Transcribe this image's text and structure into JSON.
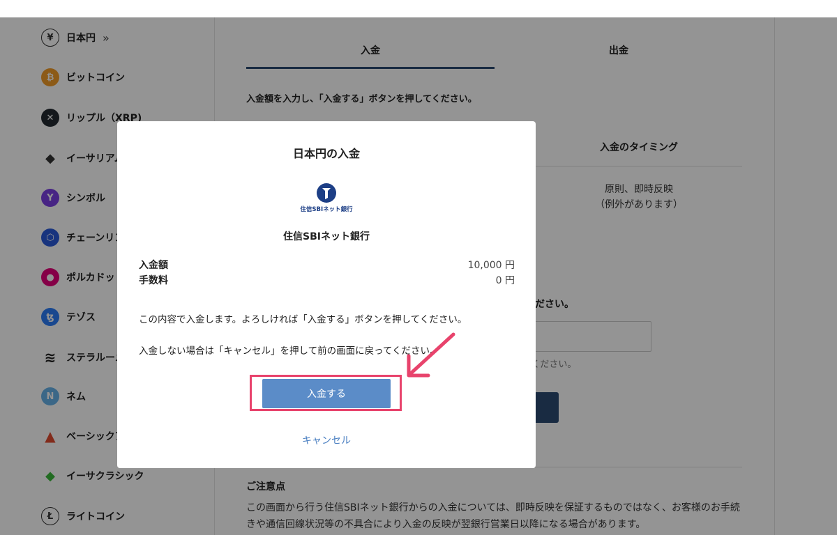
{
  "sidebar": {
    "items": [
      {
        "label": "日本円",
        "glyph": "¥",
        "color": "#ffffff",
        "extra": "»"
      },
      {
        "label": "ビットコイン",
        "glyph": "₿",
        "color": "#f29b29"
      },
      {
        "label": "リップル（XRP)",
        "glyph": "✕",
        "color": "#232a31"
      },
      {
        "label": "イーサリアム",
        "glyph": "◆",
        "color": "#ffffff"
      },
      {
        "label": "シンボル",
        "glyph": "Y",
        "color": "#7b3fe4"
      },
      {
        "label": "チェーンリン",
        "glyph": "⬡",
        "color": "#2a5ada"
      },
      {
        "label": "ポルカドット",
        "glyph": "●",
        "color": "#e6007a"
      },
      {
        "label": "テゾス",
        "glyph": "ꜩ",
        "color": "#2c7df7"
      },
      {
        "label": "ステラルーメ",
        "glyph": "≋",
        "color": "#ffffff"
      },
      {
        "label": "ネム",
        "glyph": "N",
        "color": "#67b2e8"
      },
      {
        "label": "ベーシックア",
        "glyph": "▲",
        "color": "#ffffff"
      },
      {
        "label": "イーサクラシック",
        "glyph": "◆",
        "color": "#ffffff"
      },
      {
        "label": "ライトコイン",
        "glyph": "Ł",
        "color": "#ffffff"
      }
    ]
  },
  "main": {
    "tabs": {
      "deposit": "入金",
      "withdraw": "出金"
    },
    "instruction": "入金額を入力し、「入金する」ボタンを押してください。",
    "timing_header": "入金のタイミング",
    "timing_line1": "原則、即時反映",
    "timing_line2": "（例外があります）",
    "amount_prompt": "ください。",
    "amount_hint": "0,000 円ご用意ください。",
    "notes_title": "ご注意点",
    "notes_body": "この画面から行う住信SBIネット銀行からの入金については、即時反映を保証するものではなく、お客様のお手続きや通信回線状況等の不具合により入金の反映が翌銀行営業日以降になる場合があります。"
  },
  "modal": {
    "title": "日本円の入金",
    "bank_logo_text": "住信SBIネット銀行",
    "bank_name": "住信SBIネット銀行",
    "amount_label": "入金額",
    "amount_value": "10,000 円",
    "fee_label": "手数料",
    "fee_value": "0 円",
    "message1": "この内容で入金します。よろしければ「入金する」ボタンを押してください。",
    "message2": "入金しない場合は「キャンセル」を押して前の画面に戻ってください。",
    "confirm_label": "入金する",
    "cancel_label": "キャンセル"
  },
  "colors": {
    "accent": "#2c4a73",
    "button": "#5b8cc8",
    "highlight": "#e8436c",
    "link": "#4a7fc1"
  }
}
